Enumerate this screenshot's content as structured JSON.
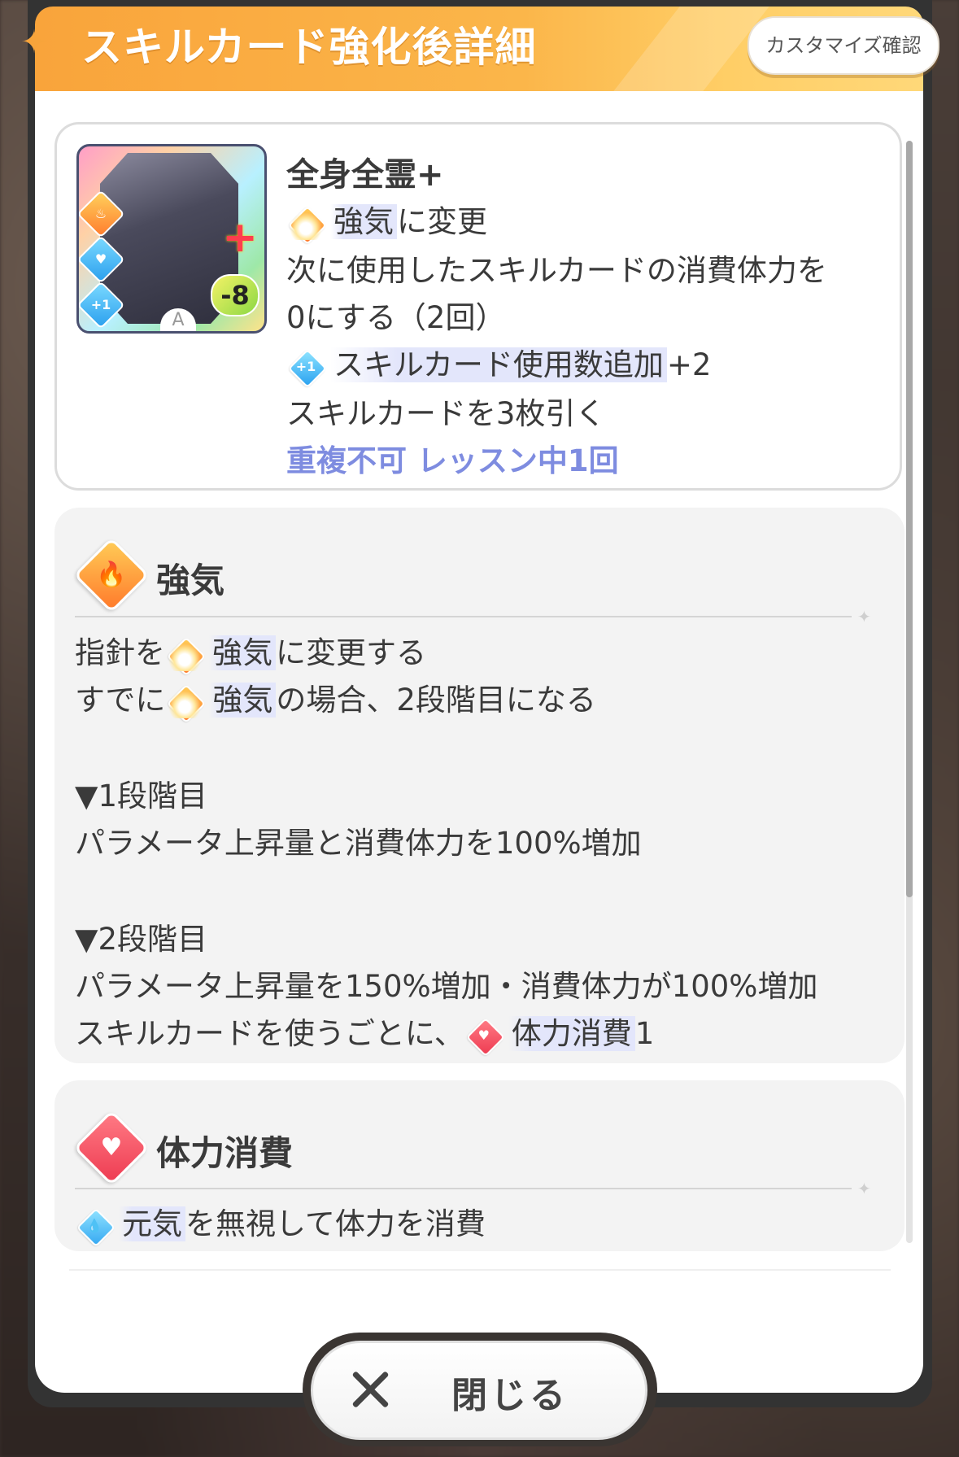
{
  "header": {
    "title": "スキルカード強化後詳細",
    "customize_label": "カスタマイズ確認"
  },
  "card": {
    "name": "全身全霊+",
    "cost": "-8",
    "rank": "A",
    "line1_tag": "強気",
    "line1_rest": "に変更",
    "line2": "次に使用したスキルカードの消費体力を",
    "line3": "0にする（2回）",
    "line4_tag": "スキルカード使用数追加",
    "line4_rest": "+2",
    "line5": "スキルカードを3枚引く",
    "restriction": "重複不可 レッスン中1回"
  },
  "section_tsuyoki": {
    "title": "強気",
    "l1_pre": "指針を",
    "l1_tag": "強気",
    "l1_post": "に変更する",
    "l2_pre": "すでに",
    "l2_tag": "強気",
    "l2_post": "の場合、2段階目になる",
    "stage1_heading": "▼1段階目",
    "stage1_text": "パラメータ上昇量と消費体力を100%増加",
    "stage2_heading": "▼2段階目",
    "stage2_text": "パラメータ上昇量を150%増加・消費体力が100%増加",
    "stage2_extra_pre": "スキルカードを使うごとに、",
    "stage2_extra_tag": "体力消費",
    "stage2_extra_post": "1"
  },
  "section_tairyoku": {
    "title": "体力消費",
    "l1_tag": "元気",
    "l1_post": "を無視して体力を消費"
  },
  "footer": {
    "close_label": "閉じる"
  },
  "colors": {
    "header_orange": "#f9a43b",
    "accent_blue_text": "#7e8ce0",
    "highlight": "#e3e6fb"
  }
}
